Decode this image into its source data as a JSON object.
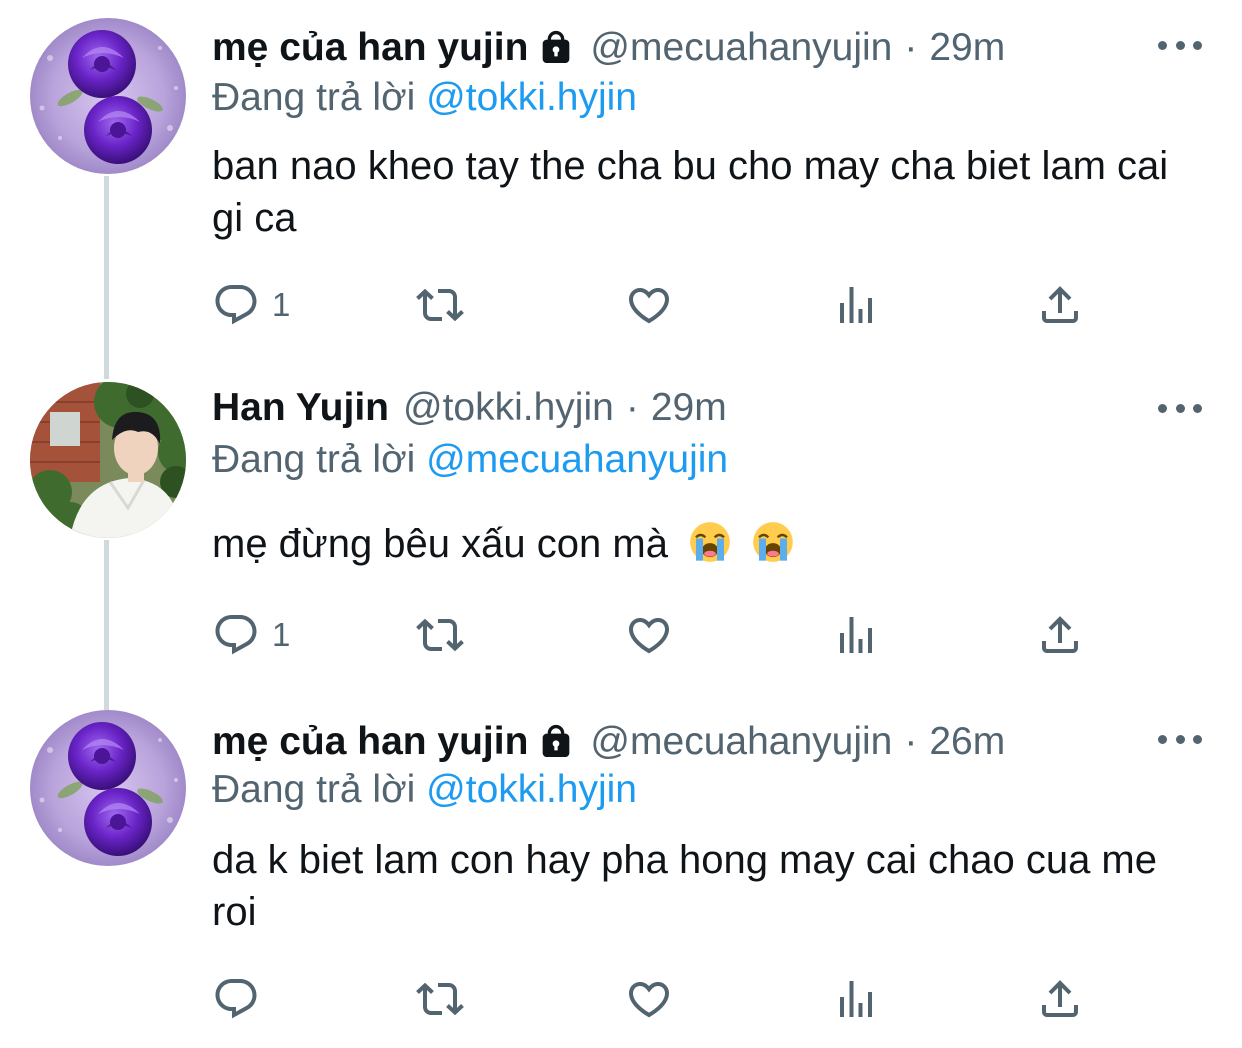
{
  "tweets": [
    {
      "display_name": "mẹ của han yujin",
      "locked": true,
      "handle": "@mecuahanyujin",
      "separator": "·",
      "time": "29m",
      "reply_prefix": "Đang trả lời",
      "reply_to": "@tokki.hyjin",
      "text": "ban nao kheo tay the cha bu cho may cha biet lam cai gi ca",
      "reply_count": "1",
      "avatar": "purple-rose"
    },
    {
      "display_name": "Han Yujin",
      "locked": false,
      "handle": "@tokki.hyjin",
      "separator": "·",
      "time": "29m",
      "reply_prefix": "Đang trả lời",
      "reply_to": "@mecuahanyujin",
      "text": "mẹ đừng bêu xấu con mà",
      "emojis": [
        "loudly-crying-face",
        "loudly-crying-face"
      ],
      "reply_count": "1",
      "avatar": "boy-white-shirt"
    },
    {
      "display_name": "mẹ của han yujin",
      "locked": true,
      "handle": "@mecuahanyujin",
      "separator": "·",
      "time": "26m",
      "reply_prefix": "Đang trả lời",
      "reply_to": "@tokki.hyjin",
      "text": "da k biet lam con hay pha hong may cai chao cua me roi",
      "reply_count": "",
      "avatar": "purple-rose"
    }
  ],
  "icons": {
    "reply": "reply-icon",
    "retweet": "retweet-icon",
    "like": "heart-icon",
    "views": "views-icon",
    "share": "share-icon",
    "more": "more-icon",
    "lock": "lock-icon"
  },
  "colors": {
    "text": "#0f1419",
    "secondary": "#536471",
    "link": "#1d9bf0",
    "thread_line": "#cfd9de"
  }
}
